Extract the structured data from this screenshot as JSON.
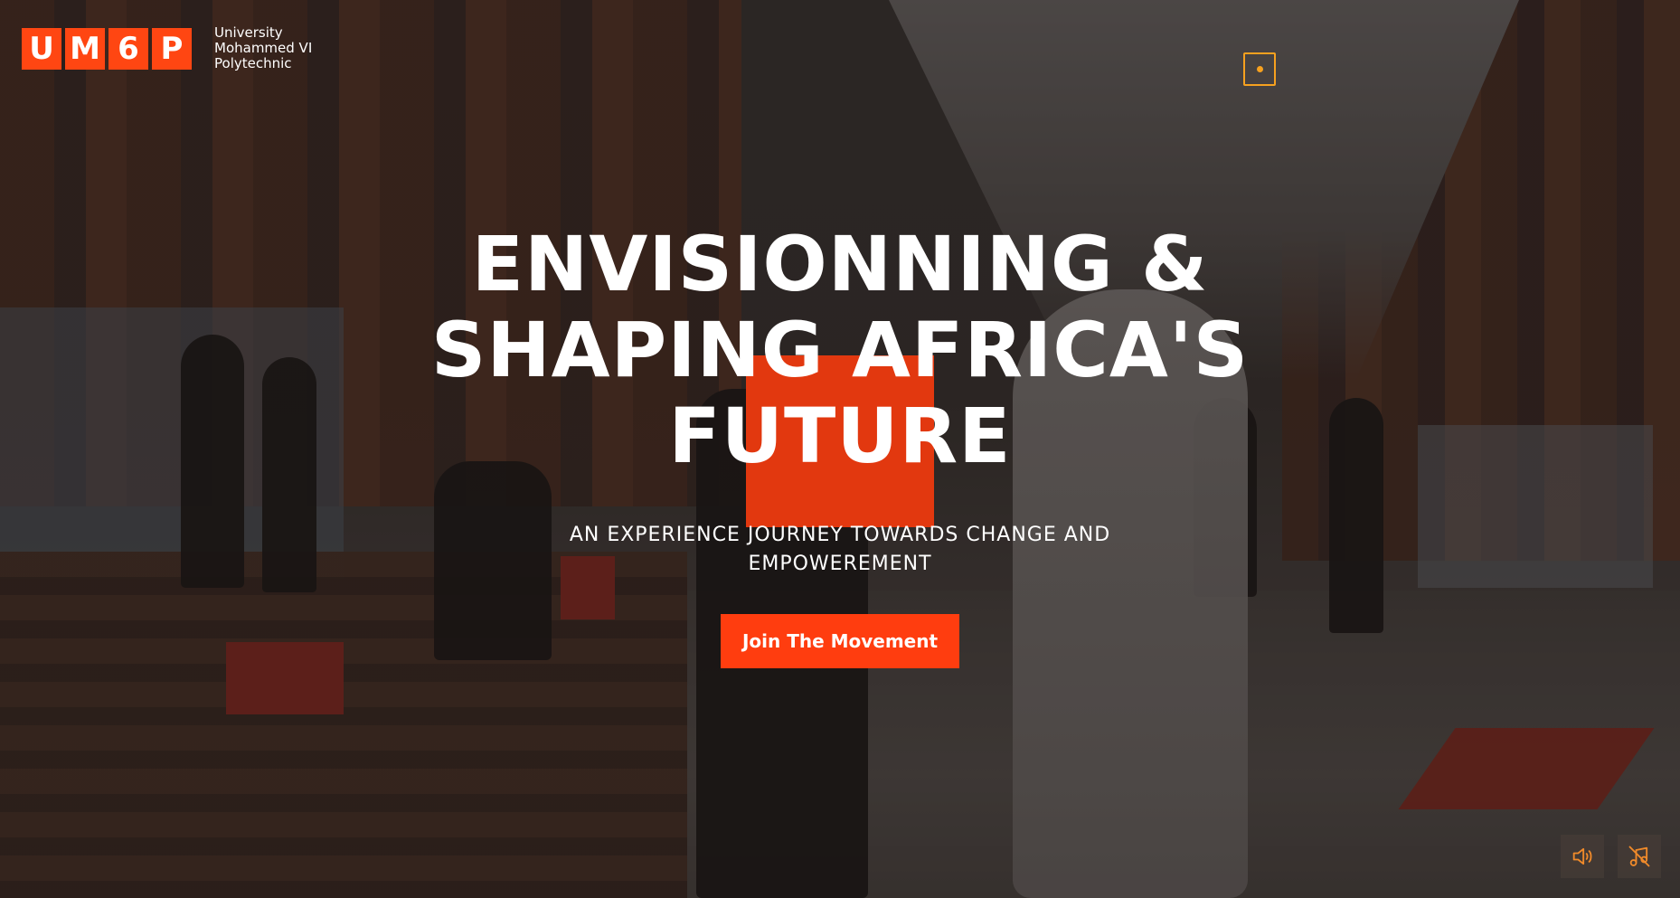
{
  "brand": {
    "letters": [
      "U",
      "M",
      "6",
      "P"
    ],
    "name_lines": [
      "University",
      "Mohammed VI",
      "Polytechnic"
    ],
    "accent_color": "#ff4612"
  },
  "nav": {
    "menu_icon": "menu-dot-icon",
    "menu_color": "#f6a11f"
  },
  "hero": {
    "title_lines": [
      "ENVISIONNING &",
      "SHAPING AFRICA'S",
      "FUTURE"
    ],
    "subtitle_lines": [
      "AN EXPERIENCE JOURNEY TOWARDS CHANGE AND",
      "EMPOWEREMENT"
    ],
    "cta_label": "Join The Movement",
    "cta_color": "#ff3d0f"
  },
  "media_controls": {
    "sound_icon": "volume-icon",
    "music_off_icon": "music-off-icon"
  }
}
